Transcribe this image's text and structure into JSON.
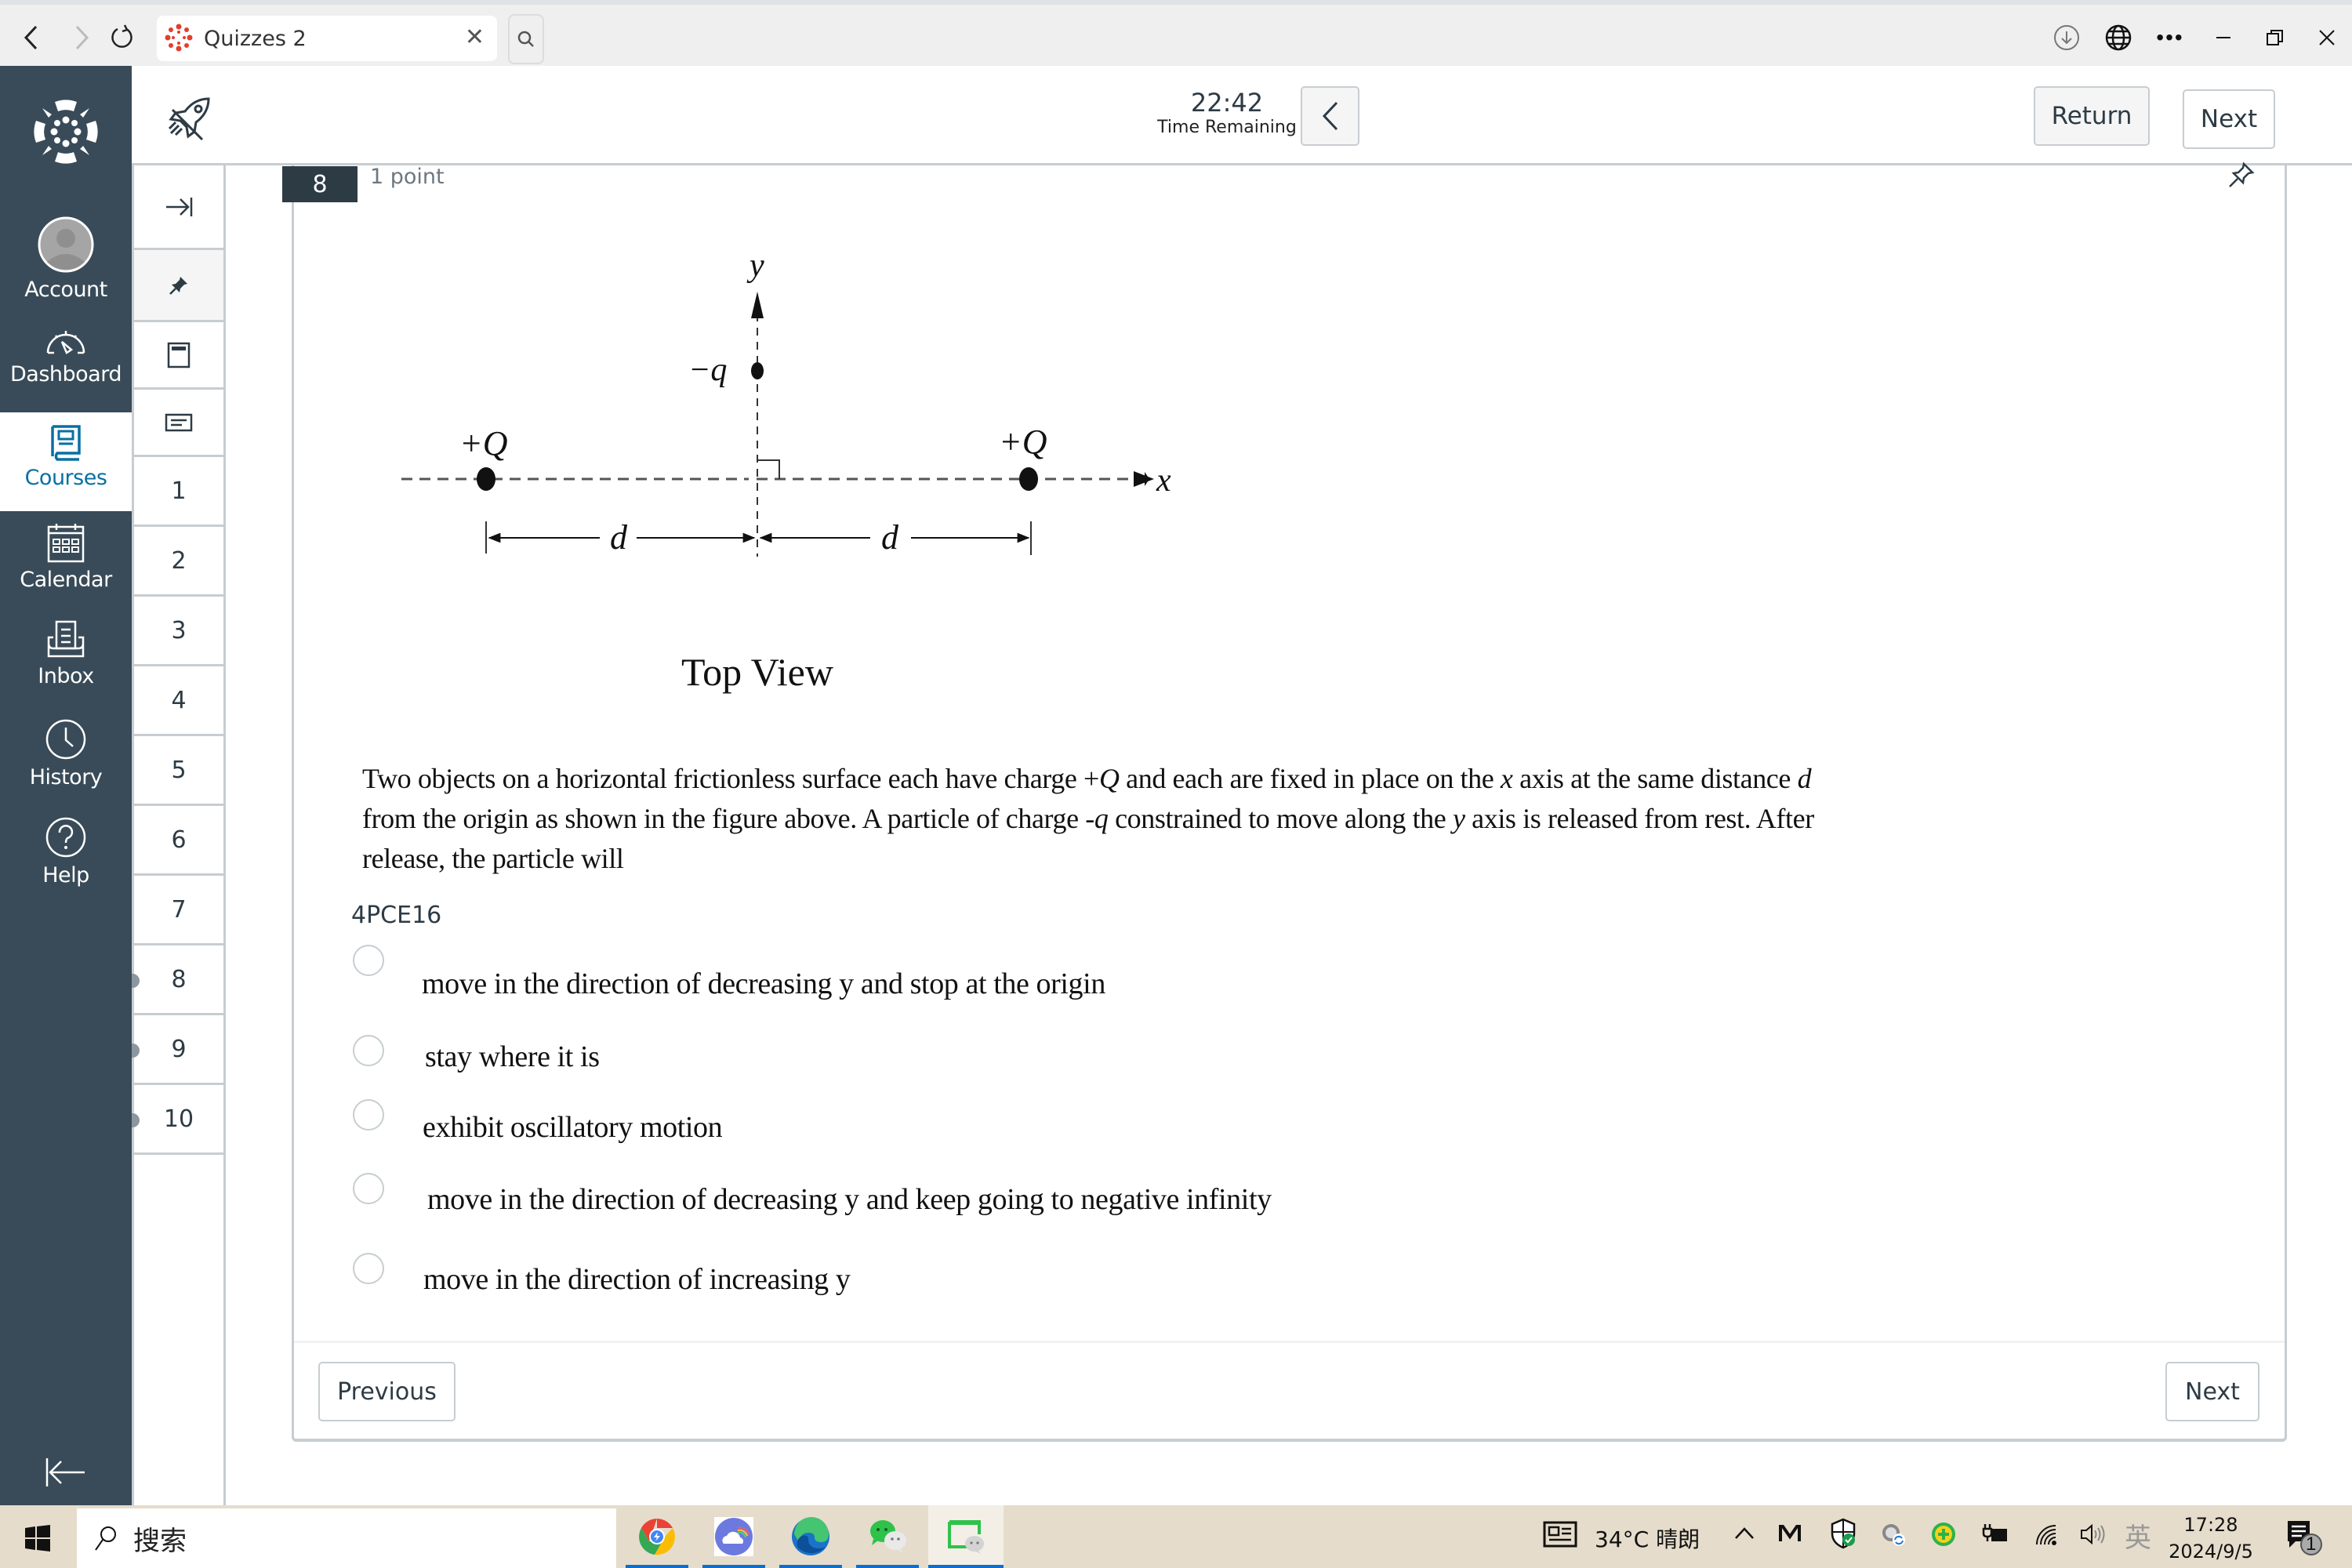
{
  "browser": {
    "tab_title": "Quizzes 2",
    "icons": [
      "back-icon",
      "forward-icon",
      "reload-icon",
      "tab-search-icon",
      "downloads-icon",
      "globe-icon",
      "more-icon",
      "minimize-icon",
      "restore-icon",
      "close-icon"
    ]
  },
  "global_nav": {
    "items": [
      {
        "label": "Account",
        "icon": "avatar-icon"
      },
      {
        "label": "Dashboard",
        "icon": "dashboard-icon"
      },
      {
        "label": "Courses",
        "icon": "courses-icon",
        "active": true
      },
      {
        "label": "Calendar",
        "icon": "calendar-icon"
      },
      {
        "label": "Inbox",
        "icon": "inbox-icon"
      },
      {
        "label": "History",
        "icon": "clock-icon"
      },
      {
        "label": "Help",
        "icon": "help-icon"
      }
    ]
  },
  "header": {
    "timer_value": "22:42",
    "timer_label": "Time Remaining",
    "return_label": "Return",
    "next_label": "Next"
  },
  "question_nav": {
    "numbers": [
      "1",
      "2",
      "3",
      "4",
      "5",
      "6",
      "7",
      "8",
      "9",
      "10"
    ],
    "marked": [
      "8",
      "9",
      "10"
    ]
  },
  "question": {
    "number": "8",
    "points": "1 point",
    "figure": {
      "y_axis_label": "y",
      "x_axis_label": "x",
      "particle_label": "−q",
      "left_charge_label": "+Q",
      "right_charge_label": "+Q",
      "distance_label_left": "d",
      "distance_label_right": "d",
      "caption": "Top View"
    },
    "text_parts": {
      "p1": "Two objects on a horizontal frictionless surface each have charge +",
      "Q": "Q",
      "p2": " and each are fixed in place on the ",
      "x": "x",
      "p3": " axis at the same distance ",
      "d": "d",
      "p4": " from the origin as shown in the figure above. A particle of charge -",
      "q": "q",
      "p5": " constrained to move along the ",
      "y": "y",
      "p6": " axis is released from rest. After release, the particle will"
    },
    "code": "4PCE16",
    "answers": [
      "move in the direction of decreasing y and stop at the origin",
      "stay where it is",
      "exhibit oscillatory motion",
      "move in the direction of decreasing y and keep going to negative infinity",
      "move in the direction of increasing y"
    ]
  },
  "footer": {
    "previous_label": "Previous",
    "next_label": "Next"
  },
  "taskbar": {
    "search_placeholder": "搜索",
    "weather": "34°C 晴朗",
    "ime": "英",
    "time": "17:28",
    "date": "2024/9/5",
    "notification_count": "1"
  }
}
